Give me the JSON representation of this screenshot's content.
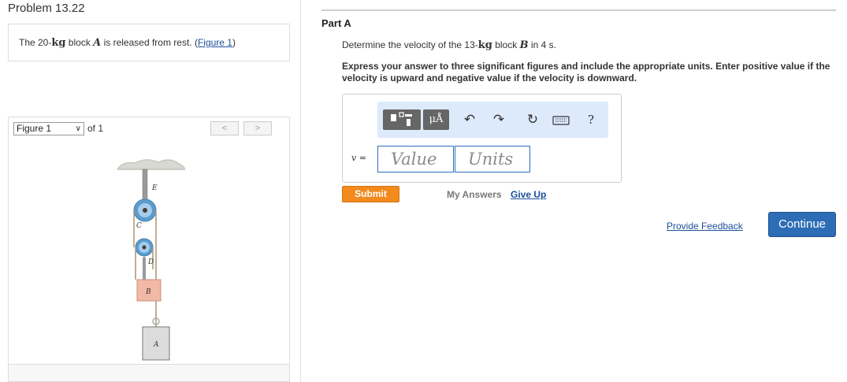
{
  "problem": {
    "title": "Problem 13.22",
    "statement_pre": "The 20-",
    "statement_unit": "kg",
    "statement_mid": " block ",
    "statement_var": "A",
    "statement_post": " is released from rest. (",
    "figure_link": "Figure 1",
    "statement_end": ")"
  },
  "figure": {
    "select_value": "Figure 1",
    "of_label": "of 1",
    "prev_icon": "chevron-left-icon",
    "next_icon": "chevron-right-icon",
    "labels": {
      "E": "E",
      "C": "C",
      "D": "D",
      "B": "B",
      "A": "A"
    }
  },
  "part": {
    "title": "Part A",
    "question_pre": "Determine the velocity of the 13-",
    "question_unit": "kg",
    "question_mid": " block ",
    "question_var": "B",
    "question_post": " in 4  s",
    "question_end": ".",
    "instructions": "Express your answer to three significant figures and include the appropriate units. Enter positive value if the velocity is upward and negative value if the velocity is downward."
  },
  "toolbar": {
    "units_label": "μÅ",
    "icons": [
      "templates-icon",
      "units-icon",
      "undo-icon",
      "redo-icon",
      "reset-icon",
      "keyboard-icon",
      "help-icon"
    ],
    "help_label": "?"
  },
  "answer": {
    "variable": "v =",
    "value_placeholder": "Value",
    "units_placeholder": "Units"
  },
  "actions": {
    "submit": "Submit",
    "my_answers": "My Answers",
    "give_up": "Give Up",
    "feedback": "Provide Feedback",
    "continue": "Continue"
  },
  "colors": {
    "link": "#1a4f9c",
    "submit": "#f28a1e",
    "continue": "#2d6db5",
    "toolbar": "#ddeafc",
    "input_border": "#2b6fb8"
  }
}
